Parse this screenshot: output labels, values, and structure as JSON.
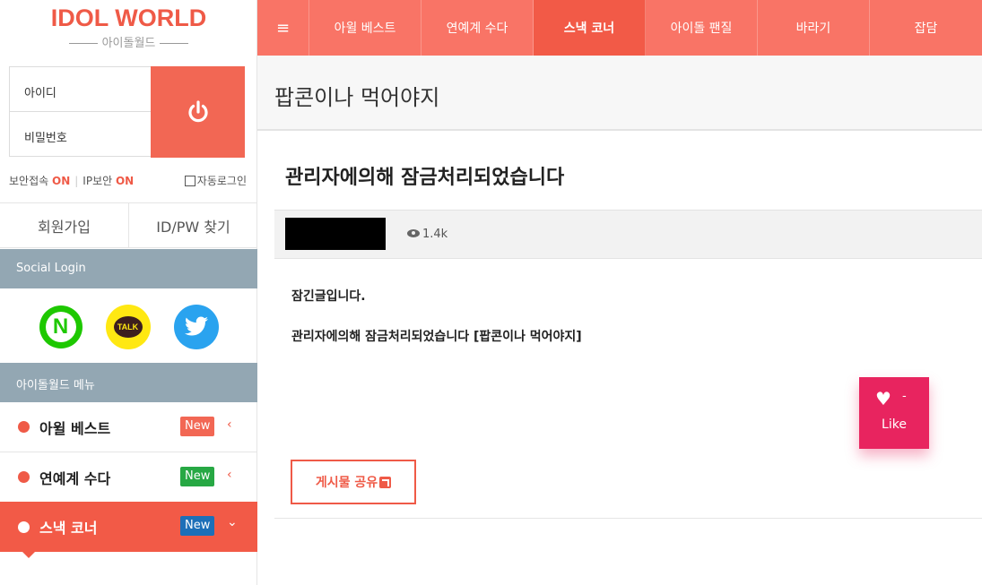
{
  "logo": {
    "title": "IDOL WORLD",
    "subtitle": "아이돌월드"
  },
  "login": {
    "id_placeholder": "아이디",
    "pw_placeholder": "비밀번호",
    "submit_icon": "power-icon"
  },
  "security": {
    "secure_label": "보안접속",
    "secure_state": "ON",
    "ip_label": "IP보안",
    "ip_state": "ON",
    "autologin_label": "자동로그인"
  },
  "account": {
    "join_label": "회원가입",
    "find_label": "ID/PW 찾기"
  },
  "social": {
    "header": "Social Login",
    "naver_letter": "N",
    "kakao_text": "TALK"
  },
  "menu": {
    "header": "아이돌월드 메뉴",
    "items": [
      {
        "label": "아윌 베스트",
        "badge": "New",
        "badge_color": "#f26754",
        "arrow": "‹"
      },
      {
        "label": "연예계 수다",
        "badge": "New",
        "badge_color": "#27a844",
        "arrow": "‹"
      },
      {
        "label": "스낵 코너",
        "badge": "New",
        "badge_color": "#1d6fb8",
        "arrow": "⌄"
      }
    ]
  },
  "topnav": {
    "menu_icon": "≡",
    "items": [
      "아윌 베스트",
      "연예계 수다",
      "스낵 코너",
      "아이돌 팬질",
      "바라기",
      "잡담"
    ],
    "active_index": 2
  },
  "board": {
    "title": "팝콘이나 먹어야지"
  },
  "post": {
    "title": "관리자에의해 잠금처리되었습니다",
    "views": "1.4k",
    "body_line1": "잠긴글입니다.",
    "body_line2": "관리자에의해 잠금처리되었습니다 [팝콘이나 먹어야지]"
  },
  "like": {
    "count": "-",
    "label": "Like"
  },
  "share": {
    "label": "게시물 공유"
  },
  "colors": {
    "accent": "#f25a47",
    "nav": "#f97466",
    "like": "#e8245f",
    "gray_bar": "#93a7b3"
  }
}
